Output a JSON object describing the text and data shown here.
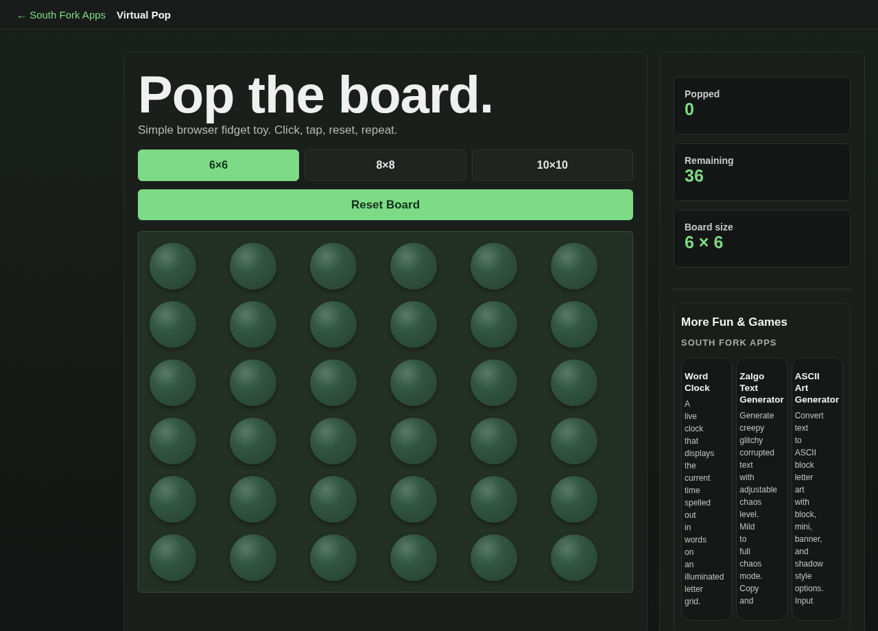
{
  "nav": {
    "back_link": "← South Fork Apps",
    "title": "Virtual Pop"
  },
  "hero": {
    "title": "Pop the board.",
    "subtitle": "Simple browser fidget toy. Click, tap, reset, repeat."
  },
  "sizes": [
    {
      "label": "6×6",
      "selected": true
    },
    {
      "label": "8×8",
      "selected": false
    },
    {
      "label": "10×10",
      "selected": false
    }
  ],
  "reset_button": "Reset Board",
  "board": {
    "bubbles": [
      {
        "popped": false
      },
      {
        "popped": false
      },
      {
        "popped": false
      },
      {
        "popped": false
      },
      {
        "popped": false
      },
      {
        "popped": false
      },
      {
        "popped": false
      },
      {
        "popped": false
      },
      {
        "popped": false
      },
      {
        "popped": false
      },
      {
        "popped": false
      },
      {
        "popped": false
      },
      {
        "popped": false
      },
      {
        "popped": false
      },
      {
        "popped": false
      },
      {
        "popped": false
      },
      {
        "popped": false
      },
      {
        "popped": false
      },
      {
        "popped": false
      },
      {
        "popped": false
      },
      {
        "popped": false
      },
      {
        "popped": false
      },
      {
        "popped": false
      },
      {
        "popped": false
      },
      {
        "popped": false
      },
      {
        "popped": false
      },
      {
        "popped": false
      },
      {
        "popped": false
      },
      {
        "popped": false
      },
      {
        "popped": false
      },
      {
        "popped": false
      },
      {
        "popped": false
      },
      {
        "popped": false
      },
      {
        "popped": false
      },
      {
        "popped": false
      },
      {
        "popped": false
      }
    ]
  },
  "stats": [
    {
      "label": "Popped",
      "value": "0"
    },
    {
      "label": "Remaining",
      "value": "36"
    },
    {
      "label": "Board size",
      "value": "6 × 6"
    }
  ],
  "more": {
    "title": "More Fun & Games",
    "subtitle": "SOUTH FORK APPS",
    "apps": [
      {
        "name": "Word Clock",
        "description": "A live clock that displays the current time spelled out in words on an illuminated letter grid."
      },
      {
        "name": "Zalgo Text Generator",
        "description": "Generate creepy glitchy corrupted text with adjustable chaos level. Mild to full chaos mode. Copy and"
      },
      {
        "name": "ASCII Art Generator",
        "description": "Convert text to ASCII block letter art with block, mini, banner, and shadow style options. Input"
      }
    ]
  }
}
